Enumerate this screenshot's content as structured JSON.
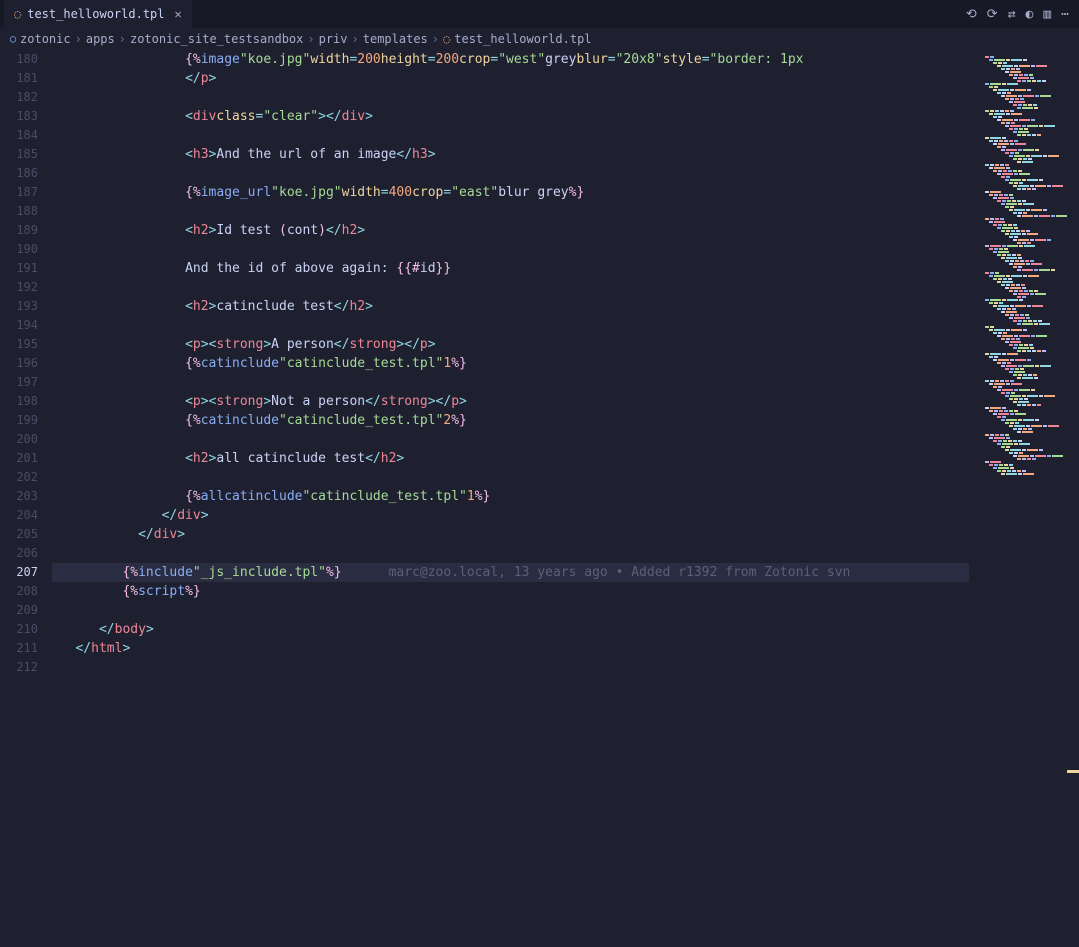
{
  "tab": {
    "file_name": "test_helloworld.tpl"
  },
  "breadcrumbs": [
    "zotonic",
    "apps",
    "zotonic_site_testsandbox",
    "priv",
    "templates",
    "test_helloworld.tpl"
  ],
  "gutter": {
    "start": 180,
    "end": 212,
    "active": 207
  },
  "blame": "marc@zoo.local, 13 years ago • Added r1392 from Zotonic svn",
  "code": {
    "l180": {
      "img_kw": "image",
      "img_file": "\"koe.jpg\"",
      "w_key": "width",
      "w_val": "200",
      "h_key": "height",
      "h_val": "200",
      "crop_key": "crop",
      "crop_val": "\"west\"",
      "grey": "grey",
      "blur_key": "blur",
      "blur_val": "\"20x8\"",
      "style_key": "style",
      "style_val": "\"border: 1px"
    },
    "l181": {
      "tag": "p"
    },
    "l183": {
      "tag": "div",
      "cls_key": "class",
      "cls_val": "\"clear\""
    },
    "l185": {
      "tag": "h3",
      "text": "And the url of an image"
    },
    "l187": {
      "kw": "image_url",
      "file": "\"koe.jpg\"",
      "w_key": "width",
      "w_val": "400",
      "crop_key": "crop",
      "crop_val": "\"east\"",
      "tail": "blur grey"
    },
    "l189": {
      "tag": "h2",
      "text": "Id test ",
      "cont": "cont"
    },
    "l191": {
      "text": "And the id of above again: ",
      "id": "id"
    },
    "l193": {
      "tag": "h2",
      "text": "catinclude test"
    },
    "l195": {
      "p": "p",
      "strong": "strong",
      "text": "A person"
    },
    "l196": {
      "kw": "catinclude",
      "file": "\"catinclude_test.tpl\"",
      "n": "1"
    },
    "l198": {
      "p": "p",
      "strong": "strong",
      "text": "Not a person"
    },
    "l199": {
      "kw": "catinclude",
      "file": "\"catinclude_test.tpl\"",
      "n": "2"
    },
    "l201": {
      "tag": "h2",
      "text": "all catinclude test"
    },
    "l203": {
      "all": "all",
      "kw": "catinclude",
      "file": "\"catinclude_test.tpl\"",
      "n": "1"
    },
    "l204": {
      "tag": "div"
    },
    "l205": {
      "tag": "div"
    },
    "l207": {
      "kw": "include",
      "file": "\"_js_include.tpl\""
    },
    "l208": {
      "kw": "script"
    },
    "l210": {
      "tag": "body"
    },
    "l211": {
      "tag": "html"
    }
  }
}
